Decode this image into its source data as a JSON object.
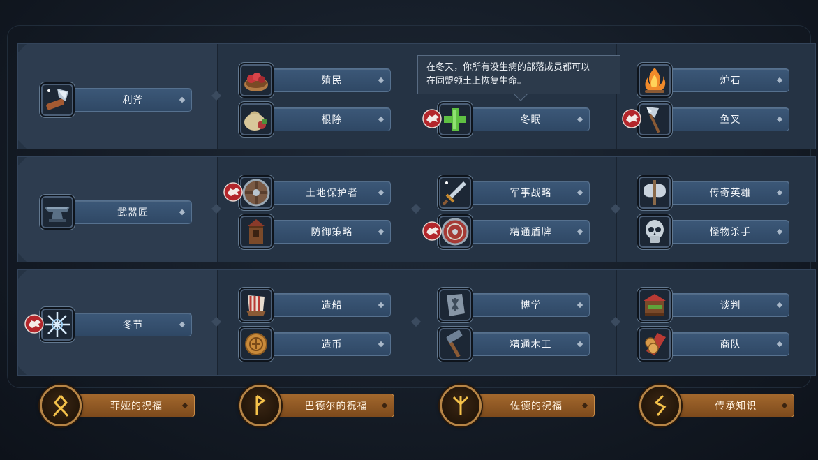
{
  "tooltip": {
    "line1": "在冬天，你所有没生病的部落成员都可以",
    "line2": "在同盟领土上恢复生命。"
  },
  "rows": [
    {
      "root": {
        "label": "利斧",
        "icon": "axe-icon",
        "badge": false
      },
      "columns": [
        [
          {
            "label": "殖民",
            "icon": "berries-basket-icon",
            "badge": false
          },
          {
            "label": "根除",
            "icon": "sack-icon",
            "badge": false
          }
        ],
        [
          {
            "label": "冬眠",
            "icon": "green-cross-icon",
            "badge": true
          }
        ],
        [
          {
            "label": "炉石",
            "icon": "campfire-icon",
            "badge": false
          },
          {
            "label": "鱼叉",
            "icon": "harpoon-icon",
            "badge": true
          }
        ]
      ]
    },
    {
      "root": {
        "label": "武器匠",
        "icon": "anvil-icon",
        "badge": false
      },
      "columns": [
        [
          {
            "label": "土地保护者",
            "icon": "round-shield-icon",
            "badge": true
          },
          {
            "label": "防御策略",
            "icon": "watchtower-icon",
            "badge": false
          }
        ],
        [
          {
            "label": "军事战略",
            "icon": "sword-icon",
            "badge": false
          },
          {
            "label": "精通盾牌",
            "icon": "red-shield-icon",
            "badge": true
          }
        ],
        [
          {
            "label": "传奇英雄",
            "icon": "battle-axe-icon",
            "badge": false
          },
          {
            "label": "怪物杀手",
            "icon": "skull-icon",
            "badge": false
          }
        ]
      ]
    },
    {
      "root": {
        "label": "冬节",
        "icon": "snowflake-icon",
        "badge": true
      },
      "columns": [
        [
          {
            "label": "造船",
            "icon": "longship-icon",
            "badge": false
          },
          {
            "label": "造币",
            "icon": "coin-icon",
            "badge": false
          }
        ],
        [
          {
            "label": "博学",
            "icon": "rune-stone-icon",
            "badge": false
          },
          {
            "label": "精通木工",
            "icon": "hammer-icon",
            "badge": false
          }
        ],
        [
          {
            "label": "谈判",
            "icon": "market-stall-icon",
            "badge": false
          },
          {
            "label": "商队",
            "icon": "coins-scroll-icon",
            "badge": false
          }
        ]
      ]
    }
  ],
  "blessings": [
    {
      "label": "菲娅的祝福",
      "icon": "othala-rune-icon"
    },
    {
      "label": "巴德尔的祝福",
      "icon": "wunjo-rune-icon"
    },
    {
      "label": "佐德的祝福",
      "icon": "algiz-rune-icon"
    },
    {
      "label": "传承知识",
      "icon": "sowilo-rune-icon"
    }
  ],
  "colors": {
    "panel": "#253344",
    "label_blue": "#3c5878",
    "blessing_gold": "#a3682d",
    "badge_red": "#b3262b"
  }
}
